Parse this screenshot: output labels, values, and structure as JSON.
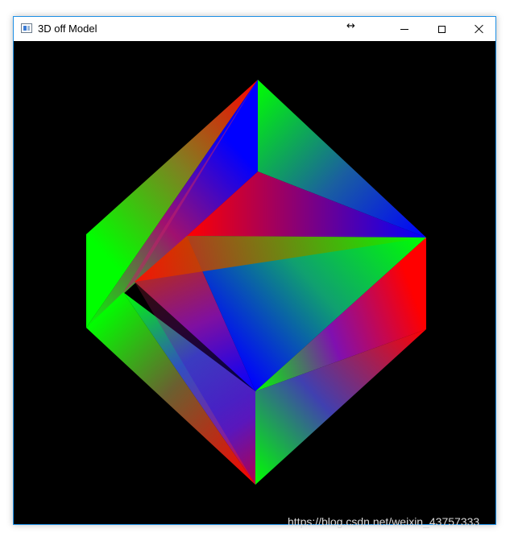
{
  "window": {
    "title": "3D off Model",
    "resize_cursor_glyph": "↔",
    "controls": {
      "minimize": "minimize",
      "maximize": "maximize",
      "close": "close"
    },
    "icons": [
      "app-window-icon",
      "minimize-icon",
      "maximize-icon",
      "close-icon",
      "resize-cursor-icon"
    ],
    "colors": {
      "canvas_background": "#000000",
      "window_border": "#1e90e6",
      "vertex_red": "#ff0000",
      "vertex_green": "#00ff00",
      "vertex_blue": "#0000ff"
    }
  },
  "watermark": "https://blog.csdn.net/weixin_43757333"
}
